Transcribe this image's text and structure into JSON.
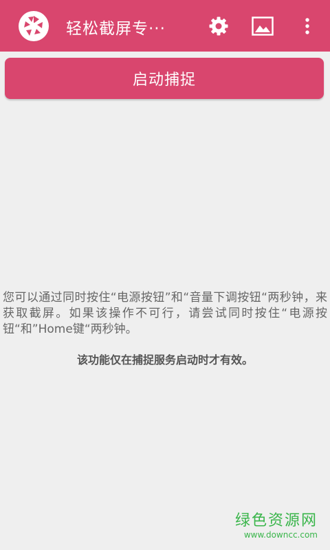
{
  "app_bar": {
    "title": "轻松截屏专···",
    "background": "#d9466e",
    "icons": {
      "logo": "camera-aperture-icon",
      "settings": "gear-icon",
      "gallery": "image-icon",
      "overflow": "more-vertical-icon"
    }
  },
  "main": {
    "capture_button_label": "启动捕捉",
    "instructions": "您可以通过同时按住“电源按钮”和“音量下调按钮“两秒钟，来获取截屏。如果该操作不可行，请尝试同时按住“电源按钮“和”Home键“两秒钟。",
    "note": "该功能仅在捕捉服务启动时才有效。"
  },
  "watermark": {
    "title": "绿色资源网",
    "url": "www.downcc.com"
  }
}
